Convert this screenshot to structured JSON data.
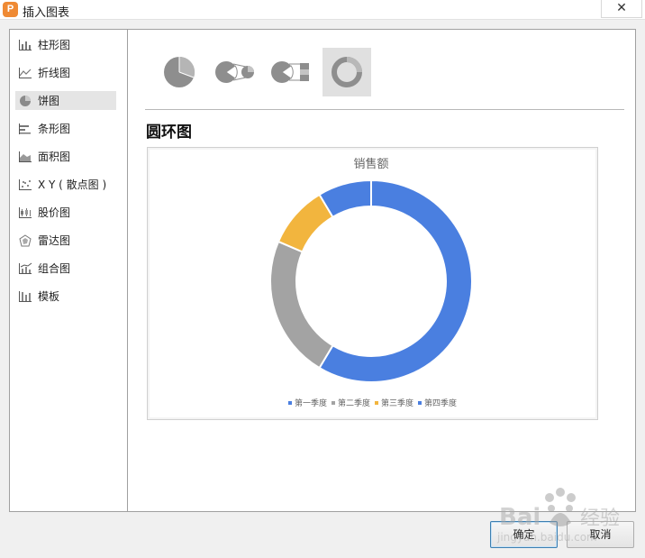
{
  "window": {
    "title": "插入图表",
    "close_glyph": "✕"
  },
  "sidebar": {
    "items": [
      {
        "label": "柱形图",
        "icon": "column-chart-icon"
      },
      {
        "label": "折线图",
        "icon": "line-chart-icon"
      },
      {
        "label": "饼图",
        "icon": "pie-chart-icon",
        "selected": true
      },
      {
        "label": "条形图",
        "icon": "bar-chart-icon"
      },
      {
        "label": "面积图",
        "icon": "area-chart-icon"
      },
      {
        "label": "X Y ( 散点图 )",
        "icon": "scatter-chart-icon"
      },
      {
        "label": "股价图",
        "icon": "stock-chart-icon"
      },
      {
        "label": "雷达图",
        "icon": "radar-chart-icon"
      },
      {
        "label": "组合图",
        "icon": "combo-chart-icon"
      },
      {
        "label": "模板",
        "icon": "template-icon"
      }
    ]
  },
  "subtypes": [
    {
      "icon": "pie-subtype-icon"
    },
    {
      "icon": "pie-of-pie-subtype-icon"
    },
    {
      "icon": "bar-of-pie-subtype-icon"
    },
    {
      "icon": "doughnut-subtype-icon",
      "selected": true
    }
  ],
  "preview": {
    "heading": "圆环图"
  },
  "chart_data": {
    "type": "pie",
    "variant": "doughnut",
    "title": "销售额",
    "categories": [
      "第一季度",
      "第二季度",
      "第三季度",
      "第四季度"
    ],
    "values": [
      8.2,
      3.2,
      1.4,
      1.2
    ],
    "colors": [
      "#4a7fe0",
      "#a3a3a3",
      "#f2b53e",
      "#4a7fe0"
    ],
    "legend": "bottom"
  },
  "buttons": {
    "ok": "确定",
    "cancel": "取消"
  },
  "watermark": {
    "brand": "Baidu 经验",
    "url": "jingyan.baidu.com"
  },
  "colors": {
    "accent": "#4a7fe0",
    "app_icon": "#ef8a34"
  }
}
